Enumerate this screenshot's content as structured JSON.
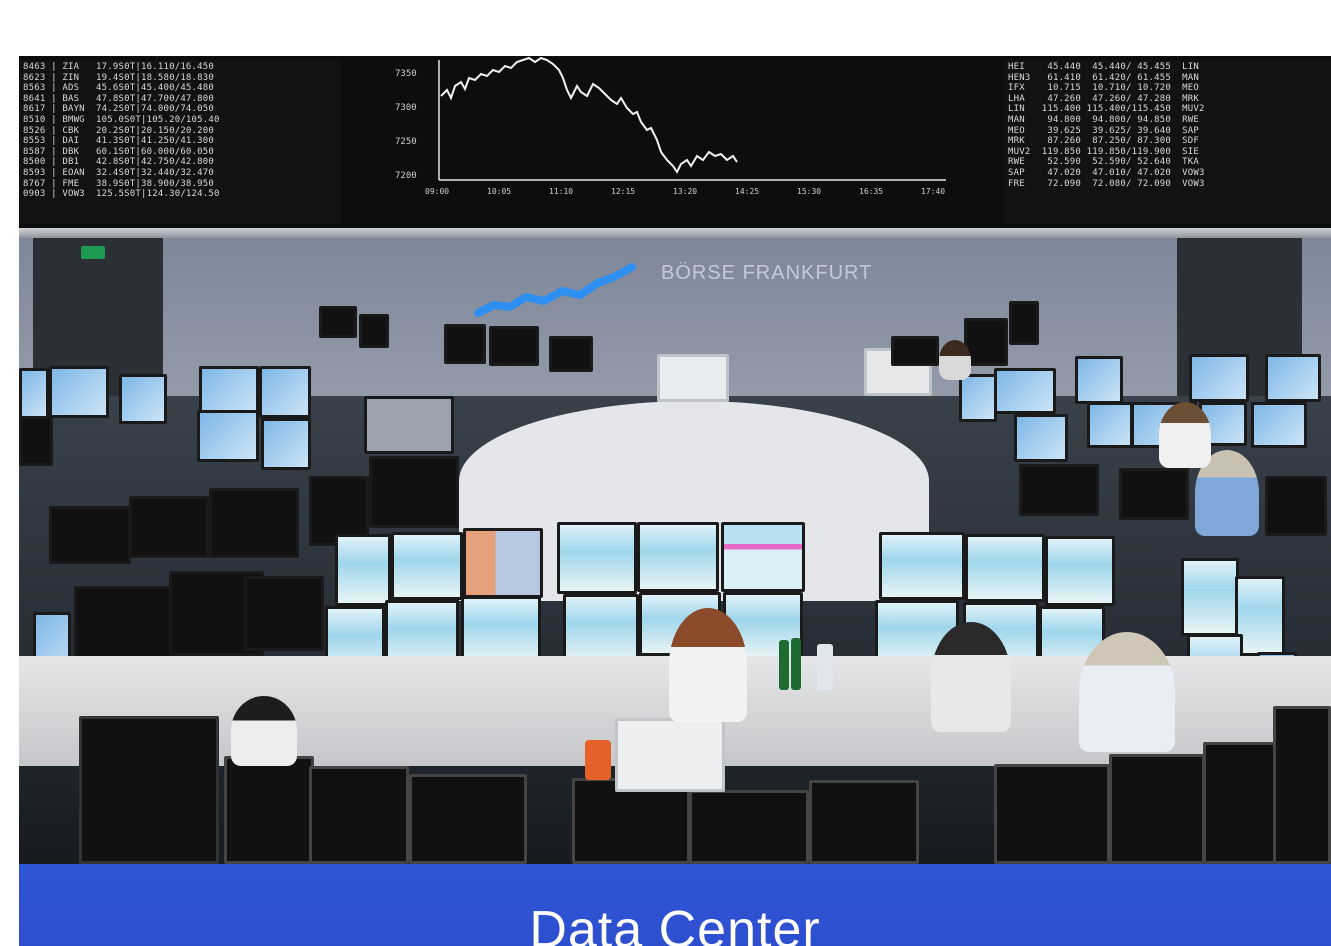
{
  "banner": {
    "title": "Data Center"
  },
  "board_left_lines": [
    "8463 | ZIA   17.9S0T|16.110/16.450",
    "8623 | ZIN   19.4S0T|18.580/18.830",
    "8563 | ADS   45.6S0T|45.400/45.480",
    "8641 | BAS   47.8S0T|47.700/47.800",
    "8617 | BAYN  74.2S0T|74.000/74.050",
    "8510 | BMWG  105.0S0T|105.20/105.40",
    "8526 | CBK   20.2S0T|20.150/20.200",
    "8553 | DAI   41.3S0T|41.250/41.300",
    "8587 | DBK   60.1S0T|60.000/60.050",
    "8500 | DB1   42.8S0T|42.750/42.800",
    "8593 | EOAN  32.4S0T|32.440/32.470",
    "8767 | FME   38.9S0T|38.900/38.950",
    "0903 | VOW3  125.5S0T|124.30/124.50"
  ],
  "board_right_lines": [
    "HEI    45.440  45.440/ 45.455  LIN",
    "HEN3   61.410  61.420/ 61.455  MAN",
    "IFX    10.715  10.710/ 10.720  MEO",
    "LHA    47.260  47.260/ 47.280  MRK",
    "LIN   115.400 115.400/115.450  MUV2",
    "MAN    94.800  94.800/ 94.850  RWE",
    "MEO    39.625  39.625/ 39.640  SAP",
    "MRK    87.260  87.250/ 87.300  SDF",
    "MUV2  119.850 119.850/119.900  SIE",
    "RWE    52.590  52.590/ 52.640  TKA",
    "SAP    47.020  47.010/ 47.020  VOW3",
    "FRE    72.090  72.080/ 72.090  VOW3"
  ],
  "board_chart": {
    "y_ticks": [
      "7350",
      "7300",
      "7250",
      "7200"
    ],
    "x_ticks": [
      "09:00",
      "10:05",
      "11:10",
      "12:15",
      "13:20",
      "14:25",
      "15:30",
      "16:35",
      "17:40"
    ]
  },
  "wall_text": "BÖRSE FRANKFURT"
}
